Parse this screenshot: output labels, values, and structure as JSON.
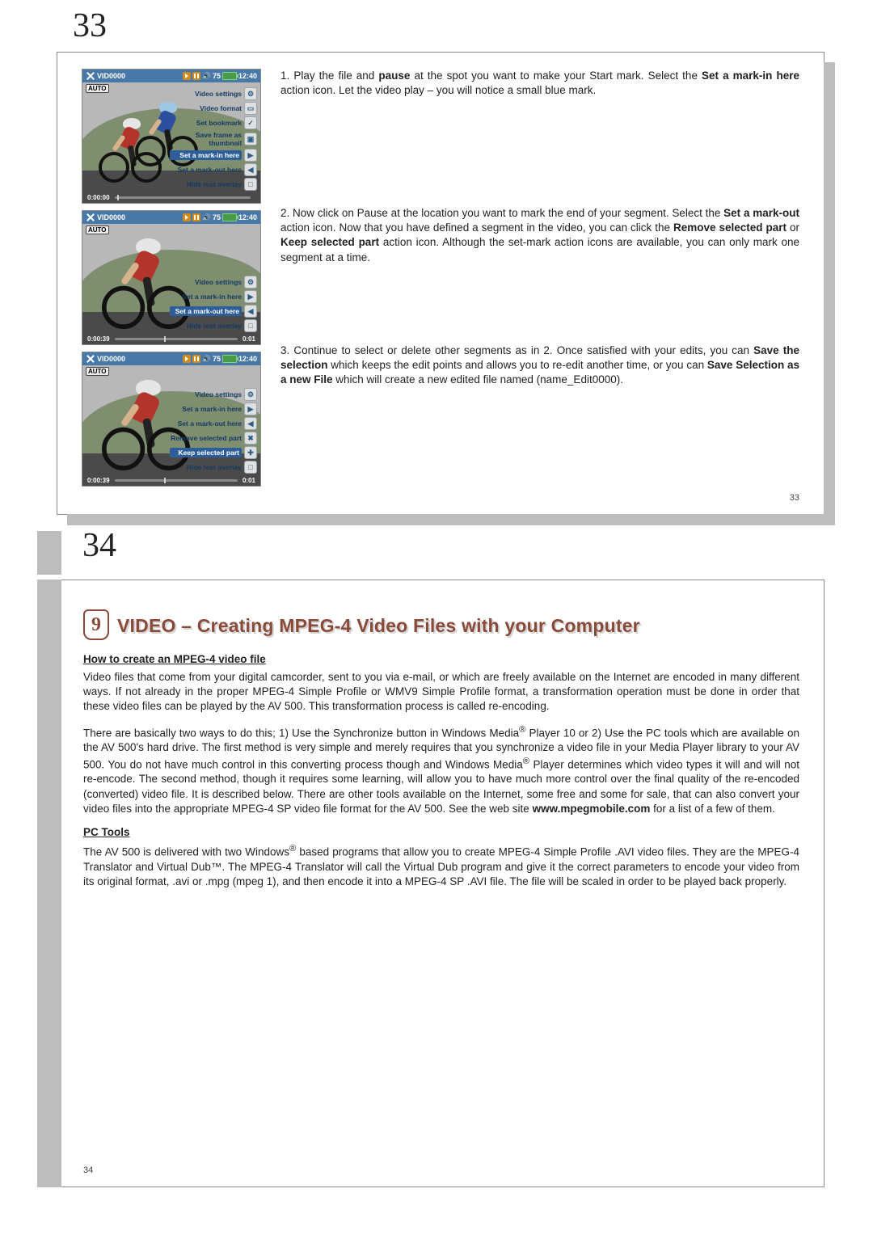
{
  "page33": {
    "big_num": "33",
    "small_num": "33",
    "thumb_header": {
      "title": "VID0000",
      "vol": "75",
      "time": "12:40",
      "auto": "AUTO"
    },
    "thumb1": {
      "bottom_left": "0:00:00",
      "menu": [
        {
          "label": "Video settings",
          "icon": "⚙"
        },
        {
          "label": "Video format",
          "icon": "▭"
        },
        {
          "label": "Set bookmark",
          "icon": "✓"
        },
        {
          "label": "Save frame as thumbnail",
          "icon": "▣"
        },
        {
          "label": "Set a mark-in here",
          "icon": "▶",
          "sel": true
        },
        {
          "label": "Set a mark-out here",
          "icon": "◀"
        },
        {
          "label": "Hide text overlay",
          "icon": "□"
        }
      ]
    },
    "thumb2": {
      "bottom_left": "0:00:39",
      "bottom_right": "0:01",
      "menu": [
        {
          "label": "Video settings",
          "icon": "⚙"
        },
        {
          "label": "Set a mark-in here",
          "icon": "▶"
        },
        {
          "label": "Set a mark-out here",
          "icon": "◀",
          "sel": true
        },
        {
          "label": "Hide text overlay",
          "icon": "□"
        }
      ]
    },
    "thumb3": {
      "bottom_left": "0:00:39",
      "bottom_right": "0:01",
      "menu": [
        {
          "label": "Video settings",
          "icon": "⚙"
        },
        {
          "label": "Set a mark-in here",
          "icon": "▶"
        },
        {
          "label": "Set a mark-out here",
          "icon": "◀"
        },
        {
          "label": "Remove selected part",
          "icon": "✖"
        },
        {
          "label": "Keep selected part",
          "icon": "✚",
          "sel": true
        },
        {
          "label": "Hide text overlay",
          "icon": "□"
        }
      ]
    },
    "steps": {
      "s1": {
        "n": "1.",
        "a": "Play the file and ",
        "b": "pause",
        "c": " at the spot you want to make your Start mark. Select the ",
        "d": "Set a mark-in here",
        "e": " action icon. Let the video play – you will notice a small blue mark."
      },
      "s2": {
        "n": "2.",
        "a": "Now click on Pause at the location you want to mark the end of your segment. Select the ",
        "b": "Set a mark-out",
        "c": " action icon. Now that you have defined a segment in the video, you can click the ",
        "d": "Remove selected part",
        "e": " or ",
        "f": "Keep selected part",
        "g": " action icon. Although the set-mark action icons are available, you can only mark one segment at a time."
      },
      "s3": {
        "n": "3.",
        "a": "Continue to select or delete other segments as in 2. Once satisfied with your edits, you can ",
        "b": "Save the selection",
        "c": " which keeps the edit points and allows you to re-edit another time, or you can ",
        "d": "Save Selection as a new File",
        "e": " which will create a new edited file named (name_Edit0000)."
      }
    }
  },
  "page34": {
    "big_num": "34",
    "small_num": "34",
    "chapter_num": "9",
    "chapter_title": "VIDEO – Creating MPEG-4 Video Files with your Computer",
    "h1": "How to create an MPEG-4 video file",
    "p1": "Video files that come from your digital camcorder, sent to you via e-mail, or which are freely available on the Internet are encoded in many different ways. If not already in the proper MPEG-4 Simple Profile or WMV9 Simple Profile format, a transformation operation must be done in order that these video files can be played by the AV 500. This transformation process is called re-encoding.",
    "p2a": "There are basically two ways to do this; 1) Use the Synchronize button in Windows Media",
    "p2b": " Player 10 or 2) Use the PC tools which are available on the AV 500's hard drive. The first method is very simple and merely requires that you synchronize a video file in your Media Player library to your AV 500. You do not have much control in this converting process though and Windows Media",
    "p2c": " Player determines which video types it will and will not re-encode. The second method, though it requires some learning, will allow you to have much more control over the final quality of the re-encoded (converted) video file. It is described below. There are other tools available on the Internet, some free and some for sale, that can also convert your video files into the appropriate MPEG-4 SP video file format for the AV 500. See the web site ",
    "p2d": "www.mpegmobile.com",
    "p2e": " for a list of a few of them.",
    "h2": "PC Tools",
    "p3a": "The AV 500 is delivered with two Windows",
    "p3b": " based programs that allow you to create MPEG-4 Simple Profile .AVI video files. They are the MPEG-4 Translator and Virtual Dub™. The MPEG-4 Translator will call the Virtual Dub program and give it the correct parameters to encode your video from its original format, .avi or .mpg (mpeg 1), and then encode it into a MPEG-4 SP .AVI file. The file will be scaled in order to be played back properly."
  }
}
